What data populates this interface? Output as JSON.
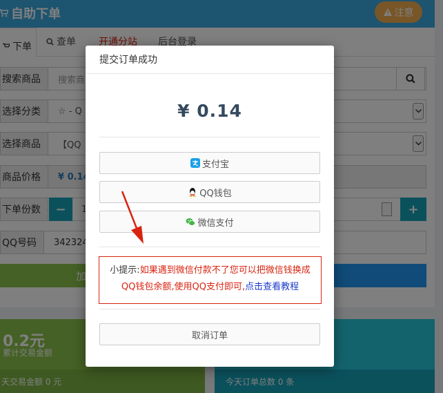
{
  "header": {
    "title": "自助下单",
    "notice_label": "注意"
  },
  "tabs": [
    {
      "label": "下单"
    },
    {
      "label": "查单"
    },
    {
      "label": "开通分站"
    },
    {
      "label": "后台登录"
    }
  ],
  "form": {
    "search_label": "搜索商品",
    "search_placeholder": "搜索商",
    "category_label": "选择分类",
    "category_value": "☆ - Q",
    "product_label": "选择商品",
    "product_value": "【QQ",
    "price_label": "商品价格",
    "price_value": "¥ 0.14",
    "qty_label": "下单份数",
    "qty_minus": "−",
    "qty_value": "1",
    "qty_plus": "+",
    "qq_label": "QQ号码",
    "qq_value": "3423242",
    "buy_left_label": "加",
    "buy_right_label": ""
  },
  "stats": {
    "total_value": "0.2元",
    "total_label": "累计交易金额",
    "today_amount_label": "天交易金额 0 元",
    "today_orders_label": "今天订单总数 0 条"
  },
  "modal": {
    "title": "提交订单成功",
    "price": "¥ 0.14",
    "pay_options": [
      {
        "label": "支付宝",
        "icon": "alipay-icon"
      },
      {
        "label": "QQ钱包",
        "icon": "qq-icon"
      },
      {
        "label": "微信支付",
        "icon": "wechat-icon"
      }
    ],
    "tip_prefix": "小提示:",
    "tip_red_1": "如果遇到微信付款不了您可以把微信钱换成",
    "tip_red_2": "QQ钱包余额,使用QQ支付即可,",
    "tip_link": "点击查看教程",
    "cancel_label": "取消订单"
  },
  "colors": {
    "header_bg": "#3aa8df",
    "notice_bg": "#f0ad4e",
    "accent_teal": "#17a2b8",
    "tip_red": "#d9230f",
    "price_text": "#34495e"
  }
}
